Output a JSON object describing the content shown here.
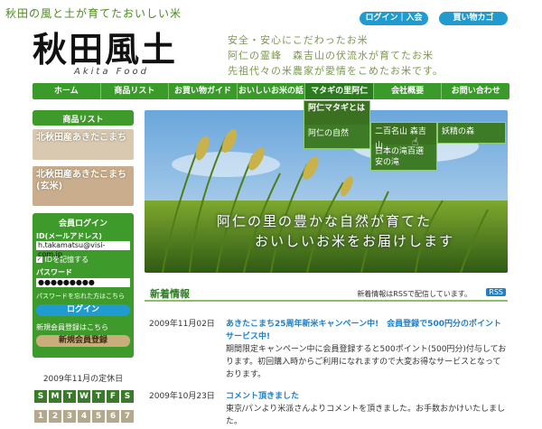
{
  "header": {
    "tagline": "秋田の風と土が育てたおいしい米",
    "login_label": "ログイン｜入会",
    "cart_label": "買い物カゴ",
    "logo_text": "秋田風土",
    "logo_sub": "Akita Food",
    "copy_lines": [
      "安全・安心にこだわったお米",
      "阿仁の霊峰　森吉山の伏流水が育てたお米",
      "先祖代々の米農家が愛情をこめたお米です。"
    ]
  },
  "nav": {
    "items": [
      "ホーム",
      "商品リスト",
      "お買い物ガイド",
      "おいしいお米の話",
      "マタギの里阿仁",
      "会社概要",
      "お問い合わせ"
    ]
  },
  "dropdown": {
    "level1": [
      "阿仁マタギとは",
      "阿仁の自然"
    ],
    "level2": [
      "二百名山 森吉山",
      "日本の滝百選 安の滝"
    ],
    "level3": [
      "妖精の森"
    ]
  },
  "sidebar": {
    "products_title": "商品リスト",
    "products": [
      {
        "label": "北秋田産あきたこまち"
      },
      {
        "label": "北秋田産あきたこまち(玄米)"
      }
    ],
    "login": {
      "title": "会員ログイン",
      "id_label": "ID(メールアドレス)",
      "id_value": "h.takamatsu@visi-com.jp",
      "remember_label": "IDを記憶する",
      "password_label": "パスワード",
      "password_value": "●●●●●●●●●",
      "forgot_link": "パスワードを忘れた方はこちら",
      "login_button": "ログイン",
      "signup_text": "新規会員登録はこちら",
      "signup_button": "新規会員登録"
    },
    "calendar": {
      "title": "2009年11月の定休日",
      "weekdays": [
        "S",
        "M",
        "T",
        "W",
        "T",
        "F",
        "S"
      ],
      "days": [
        "1",
        "2",
        "3",
        "4",
        "5",
        "6",
        "7"
      ]
    }
  },
  "hero": {
    "line1": "阿仁の里の豊かな自然が育てた",
    "line2": "おいしいお米をお届けします"
  },
  "news": {
    "title": "新着情報",
    "rss_text": "新着情報はRSSで配信しています。",
    "rss_link": "RSS",
    "rss_badge": "RSS",
    "items": [
      {
        "date": "2009年11月02日",
        "headline": "あきたこまち25周年新米キャンペーン中!　会員登録で500円分のポイントサービス中!",
        "body": "期間限定キャンペーン中に会員登録すると500ポイント(500円分)付与しております。初回購入時からご利用になれますので大変お得なサービスとなっております。"
      },
      {
        "date": "2009年10月23日",
        "headline": "コメント頂きました",
        "body": "東京/パンより米派さんよりコメントを頂きました。お手数おかけいたしました。"
      }
    ]
  },
  "colors": {
    "nav_green": "#3a9a2a",
    "accent_blue": "#1f9bd0",
    "headline_blue": "#1f80c8"
  }
}
